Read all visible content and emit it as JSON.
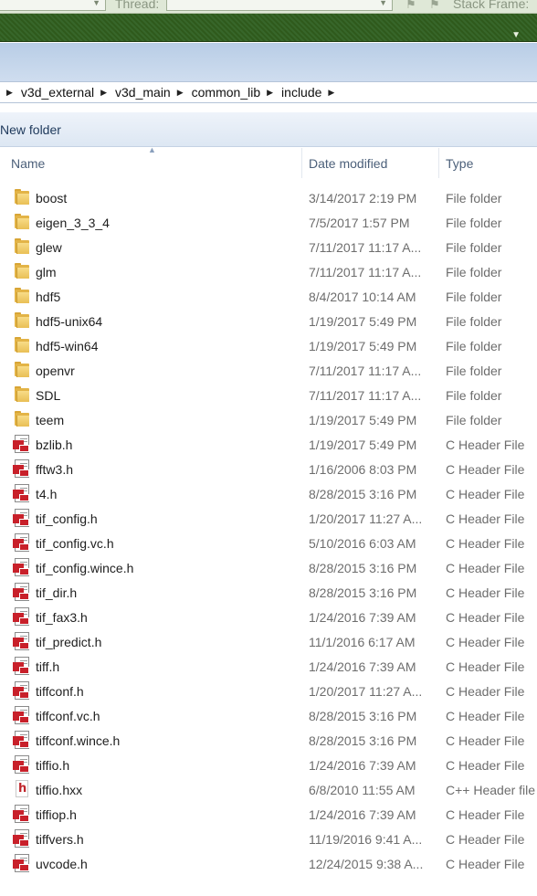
{
  "debug_toolbar": {
    "thread_label": "Thread:",
    "thread_value": "",
    "stack_frame_label": "Stack Frame:"
  },
  "breadcrumb": [
    "v3d_external",
    "v3d_main",
    "common_lib",
    "include"
  ],
  "command_bar": {
    "new_folder_label": "New folder"
  },
  "columns": {
    "name": "Name",
    "date_modified": "Date modified",
    "type": "Type"
  },
  "icon_names": {
    "folder": "folder-icon",
    "header": "c-header-icon",
    "hxx": "cpp-header-icon"
  },
  "files": [
    {
      "name": "boost",
      "date": "3/14/2017 2:19 PM",
      "type": "File folder",
      "kind": "folder"
    },
    {
      "name": "eigen_3_3_4",
      "date": "7/5/2017 1:57 PM",
      "type": "File folder",
      "kind": "folder"
    },
    {
      "name": "glew",
      "date": "7/11/2017 11:17 A...",
      "type": "File folder",
      "kind": "folder"
    },
    {
      "name": "glm",
      "date": "7/11/2017 11:17 A...",
      "type": "File folder",
      "kind": "folder"
    },
    {
      "name": "hdf5",
      "date": "8/4/2017 10:14 AM",
      "type": "File folder",
      "kind": "folder"
    },
    {
      "name": "hdf5-unix64",
      "date": "1/19/2017 5:49 PM",
      "type": "File folder",
      "kind": "folder"
    },
    {
      "name": "hdf5-win64",
      "date": "1/19/2017 5:49 PM",
      "type": "File folder",
      "kind": "folder"
    },
    {
      "name": "openvr",
      "date": "7/11/2017 11:17 A...",
      "type": "File folder",
      "kind": "folder"
    },
    {
      "name": "SDL",
      "date": "7/11/2017 11:17 A...",
      "type": "File folder",
      "kind": "folder"
    },
    {
      "name": "teem",
      "date": "1/19/2017 5:49 PM",
      "type": "File folder",
      "kind": "folder"
    },
    {
      "name": "bzlib.h",
      "date": "1/19/2017 5:49 PM",
      "type": "C Header File",
      "kind": "header"
    },
    {
      "name": "fftw3.h",
      "date": "1/16/2006 8:03 PM",
      "type": "C Header File",
      "kind": "header"
    },
    {
      "name": "t4.h",
      "date": "8/28/2015 3:16 PM",
      "type": "C Header File",
      "kind": "header"
    },
    {
      "name": "tif_config.h",
      "date": "1/20/2017 11:27 A...",
      "type": "C Header File",
      "kind": "header"
    },
    {
      "name": "tif_config.vc.h",
      "date": "5/10/2016 6:03 AM",
      "type": "C Header File",
      "kind": "header"
    },
    {
      "name": "tif_config.wince.h",
      "date": "8/28/2015 3:16 PM",
      "type": "C Header File",
      "kind": "header"
    },
    {
      "name": "tif_dir.h",
      "date": "8/28/2015 3:16 PM",
      "type": "C Header File",
      "kind": "header"
    },
    {
      "name": "tif_fax3.h",
      "date": "1/24/2016 7:39 AM",
      "type": "C Header File",
      "kind": "header"
    },
    {
      "name": "tif_predict.h",
      "date": "11/1/2016 6:17 AM",
      "type": "C Header File",
      "kind": "header"
    },
    {
      "name": "tiff.h",
      "date": "1/24/2016 7:39 AM",
      "type": "C Header File",
      "kind": "header"
    },
    {
      "name": "tiffconf.h",
      "date": "1/20/2017 11:27 A...",
      "type": "C Header File",
      "kind": "header"
    },
    {
      "name": "tiffconf.vc.h",
      "date": "8/28/2015 3:16 PM",
      "type": "C Header File",
      "kind": "header"
    },
    {
      "name": "tiffconf.wince.h",
      "date": "8/28/2015 3:16 PM",
      "type": "C Header File",
      "kind": "header"
    },
    {
      "name": "tiffio.h",
      "date": "1/24/2016 7:39 AM",
      "type": "C Header File",
      "kind": "header"
    },
    {
      "name": "tiffio.hxx",
      "date": "6/8/2010 11:55 AM",
      "type": "C++ Header file",
      "kind": "hxx"
    },
    {
      "name": "tiffiop.h",
      "date": "1/24/2016 7:39 AM",
      "type": "C Header File",
      "kind": "header"
    },
    {
      "name": "tiffvers.h",
      "date": "11/19/2016 9:41 A...",
      "type": "C Header File",
      "kind": "header"
    },
    {
      "name": "uvcode.h",
      "date": "12/24/2015 9:38 A...",
      "type": "C Header File",
      "kind": "header"
    }
  ]
}
